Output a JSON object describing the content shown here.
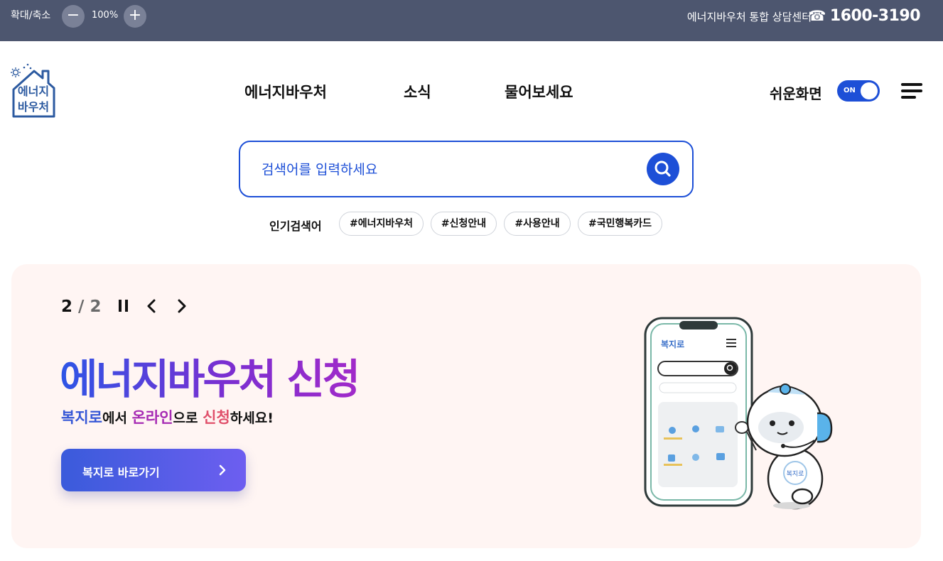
{
  "topbar": {
    "zoom_label": "확대/축소",
    "zoom_minus": "−",
    "zoom_value": "100%",
    "zoom_plus": "+",
    "hotline_label": "에너지바우처 통합 상담센터",
    "hotline_icon": "phone-icon",
    "hotline_number": "1600-3190",
    "background": "#4d566f"
  },
  "header": {
    "logo_text_1": "에너지",
    "logo_text_2": "바우처",
    "nav": [
      {
        "label": "에너지바우처"
      },
      {
        "label": "소식"
      },
      {
        "label": "물어보세요"
      }
    ],
    "easy_mode_label": "쉬운화면",
    "easy_mode_toggle": "ON",
    "menu_icon": "hamburger-menu-icon"
  },
  "search": {
    "placeholder": "검색어를 입력하세요",
    "value": "",
    "button_icon": "search-icon",
    "accent": "#1d4fd7"
  },
  "popular": {
    "label": "인기검색어",
    "tags": [
      "#에너지바우처",
      "#신청안내",
      "#사용안내",
      "#국민행복카드"
    ]
  },
  "banner": {
    "current": "2",
    "separator": "/",
    "total": "2",
    "pause_icon": "pause-icon",
    "prev_icon": "chevron-left-icon",
    "next_icon": "chevron-right-icon",
    "title": "에너지바우처 신청",
    "subtitle": {
      "part1": "복지로",
      "part2": "에서",
      "part3": "온라인",
      "part4": "으로",
      "part5": "신청",
      "part6": "하세요!"
    },
    "cta_label": "복지로 바로가기",
    "cta_icon": "chevron-right-icon",
    "phone_app_name": "복지로",
    "mascot_badge": "복지로",
    "background": "#fff5f3"
  }
}
